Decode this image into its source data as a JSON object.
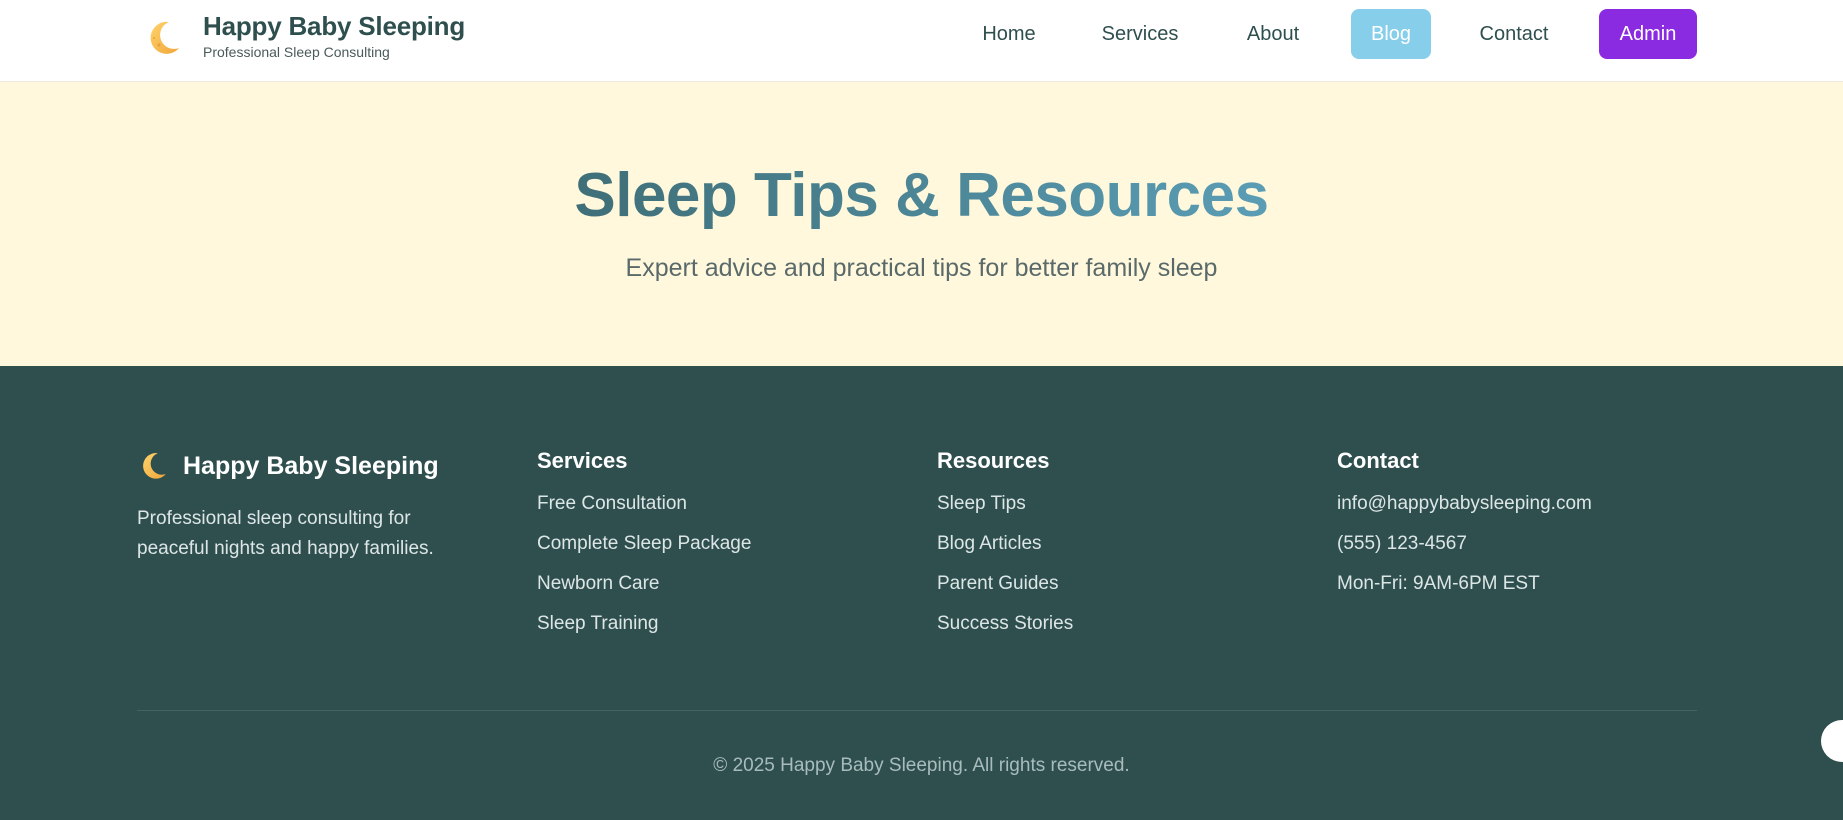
{
  "header": {
    "brand_title": "Happy Baby Sleeping",
    "brand_subtitle": "Professional Sleep Consulting",
    "brand_icon": "moon-icon",
    "nav": {
      "home": "Home",
      "services": "Services",
      "about": "About",
      "blog": "Blog",
      "contact": "Contact",
      "admin": "Admin"
    },
    "active_nav": "blog"
  },
  "hero": {
    "title": "Sleep Tips & Resources",
    "subtitle": "Expert advice and practical tips for better family sleep"
  },
  "footer": {
    "brand_title": "Happy Baby Sleeping",
    "brand_icon": "moon-icon",
    "description": "Professional sleep consulting for peaceful nights and happy families.",
    "columns": [
      {
        "heading": "Services",
        "items": [
          "Free Consultation",
          "Complete Sleep Package",
          "Newborn Care",
          "Sleep Training"
        ]
      },
      {
        "heading": "Resources",
        "items": [
          "Sleep Tips",
          "Blog Articles",
          "Parent Guides",
          "Success Stories"
        ]
      },
      {
        "heading": "Contact",
        "items": [
          "info@happybabysleeping.com",
          "(555) 123-4567",
          "Mon-Fri: 9AM-6PM EST"
        ]
      }
    ],
    "copyright": "© 2025 Happy Baby Sleeping. All rights reserved."
  },
  "colors": {
    "primary": "#2f4f4f",
    "hero_bg": "#fff8dc",
    "blog_active": "#87ceeb",
    "admin": "#8a2be2"
  }
}
